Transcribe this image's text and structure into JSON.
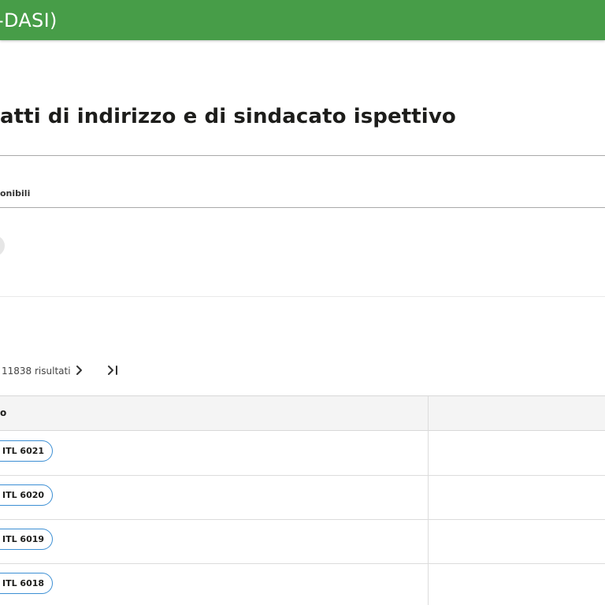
{
  "header": {
    "title": "-DASI)",
    "background_color": "#479d48"
  },
  "page": {
    "title": "atti di indirizzo e di sindacato ispettivo"
  },
  "filters": {
    "label": "onibili"
  },
  "pagination": {
    "results": "11838 risultati",
    "next_icon": "chevron-right-icon",
    "last_icon": "last-page-icon"
  },
  "table": {
    "columns": [
      "o",
      ""
    ],
    "rows": [
      {
        "atto": "ITL 6021"
      },
      {
        "atto": "ITL 6020"
      },
      {
        "atto": "ITL 6019"
      },
      {
        "atto": "ITL 6018"
      }
    ],
    "chip_border_color": "#3c8fd4"
  }
}
